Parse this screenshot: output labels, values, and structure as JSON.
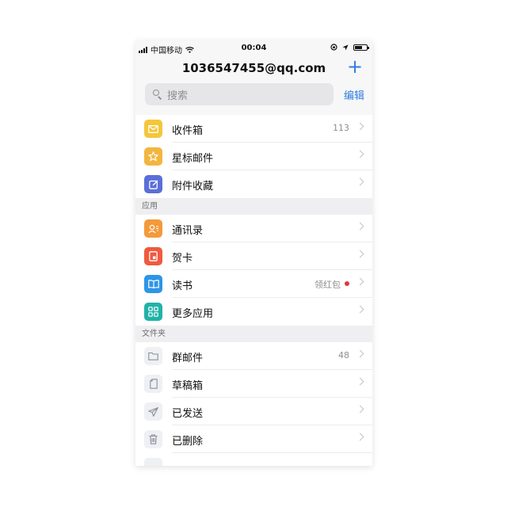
{
  "status": {
    "carrier": "中国移动",
    "time": "00:04"
  },
  "header": {
    "title": "1036547455@qq.com",
    "add_label": "+"
  },
  "search": {
    "placeholder": "搜索",
    "edit_label": "编辑"
  },
  "colors": {
    "accent": "#2f7de0",
    "inbox": "#f5c63a",
    "starred": "#f2b63f",
    "attachments": "#5a6fd7",
    "contacts": "#f39a3b",
    "cards": "#ef5a3f",
    "reading": "#2e95e6",
    "more": "#22b2a7",
    "red_dot": "#e0383e"
  },
  "mailboxes": [
    {
      "label": "收件箱",
      "count": "113",
      "icon": "envelope-icon"
    },
    {
      "label": "星标邮件",
      "count": "",
      "icon": "star-icon"
    },
    {
      "label": "附件收藏",
      "count": "",
      "icon": "attachment-icon"
    }
  ],
  "apps": {
    "section_title": "应用",
    "items": [
      {
        "label": "通讯录",
        "icon": "contacts-icon"
      },
      {
        "label": "贺卡",
        "icon": "card-icon"
      },
      {
        "label": "读书",
        "badge": "领红包",
        "icon": "book-icon"
      },
      {
        "label": "更多应用",
        "icon": "grid-icon"
      }
    ]
  },
  "folders": {
    "section_title": "文件夹",
    "items": [
      {
        "label": "群邮件",
        "count": "48",
        "icon": "folder-icon"
      },
      {
        "label": "草稿箱",
        "count": "",
        "icon": "draft-icon"
      },
      {
        "label": "已发送",
        "count": "",
        "icon": "send-icon"
      },
      {
        "label": "已删除",
        "count": "",
        "icon": "trash-icon"
      }
    ]
  }
}
